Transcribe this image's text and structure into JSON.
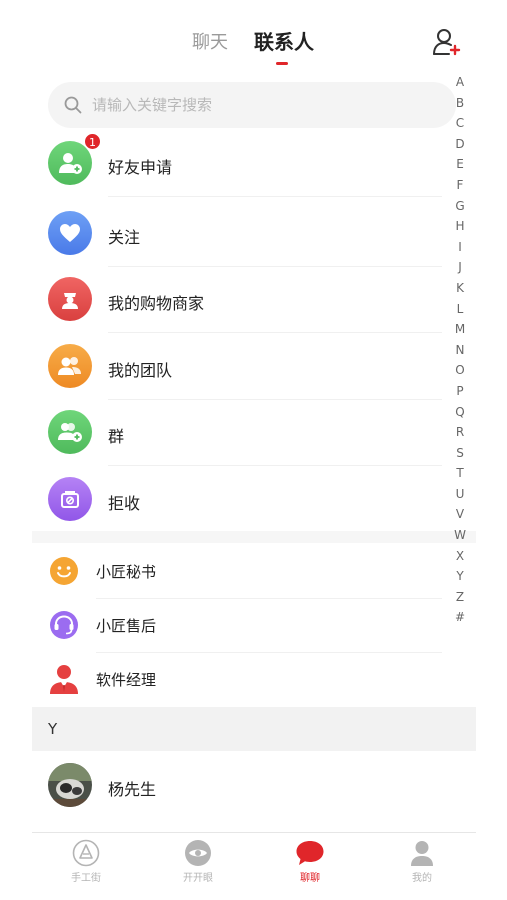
{
  "header": {
    "tab_chat": "聊天",
    "tab_contacts": "联系人",
    "add_contact_icon": "person-add-icon"
  },
  "search": {
    "placeholder": "请输入关键字搜索",
    "value": ""
  },
  "alphabet_index": [
    "A",
    "B",
    "C",
    "D",
    "E",
    "F",
    "G",
    "H",
    "I",
    "J",
    "K",
    "L",
    "M",
    "N",
    "O",
    "P",
    "Q",
    "R",
    "S",
    "T",
    "U",
    "V",
    "W",
    "X",
    "Y",
    "Z",
    "#"
  ],
  "main_entries": [
    {
      "label": "好友申请",
      "icon": "person-add-icon",
      "color": "#5fc96b",
      "badge": "1"
    },
    {
      "label": "关注",
      "icon": "heart-icon",
      "color": "#5b8df0"
    },
    {
      "label": "我的购物商家",
      "icon": "merchant-icon",
      "color": "#e8504f"
    },
    {
      "label": "我的团队",
      "icon": "team-icon",
      "color": "#f39a33"
    },
    {
      "label": "群",
      "icon": "group-add-icon",
      "color": "#5dc46d"
    },
    {
      "label": "拒收",
      "icon": "block-icon",
      "color": "#a36ef0"
    }
  ],
  "service_entries": [
    {
      "label": "小匠秘书",
      "icon": "smile-face-icon",
      "color": "#f5a533"
    },
    {
      "label": "小匠售后",
      "icon": "headset-icon",
      "color": "#9b6cf0"
    },
    {
      "label": "软件经理",
      "icon": "manager-icon",
      "color": "#e54040"
    }
  ],
  "sections": [
    {
      "letter": "Y",
      "contacts": [
        {
          "name": "杨先生",
          "icon": "photo-avatar"
        }
      ]
    }
  ],
  "bottom_nav": [
    {
      "label": "手工街",
      "icon": "shop-icon",
      "active": false
    },
    {
      "label": "开开眼",
      "icon": "eye-icon",
      "active": false
    },
    {
      "label": "聊聊",
      "icon": "chat-bubble-icon",
      "active": true
    },
    {
      "label": "我的",
      "icon": "profile-icon",
      "active": false
    }
  ],
  "colors": {
    "accent": "#e0262a"
  }
}
